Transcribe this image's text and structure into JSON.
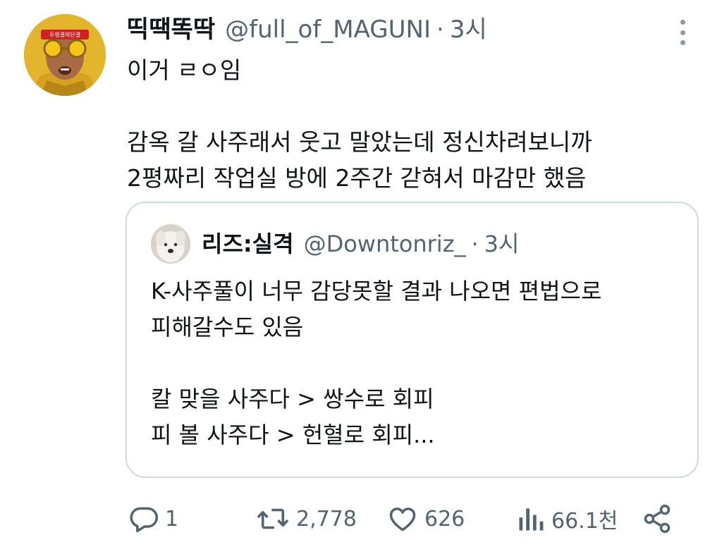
{
  "tweet": {
    "display_name": "띡땍똑딱",
    "handle": "@full_of_MAGUNI",
    "separator": "·",
    "time": "3시",
    "avatar_icon": "profile-avatar",
    "headband_text": "투쟁결의단결",
    "text": "이거 ㄹㅇ임\n\n감옥 갈 사주래서 웃고 말았는데 정신차려보니까\n2평짜리 작업실 방에 2주간 갇혀서 마감만 했음"
  },
  "quote": {
    "display_name": "리즈:실격",
    "handle": "@Downtonriz_",
    "separator": "·",
    "time": "3시",
    "avatar_icon": "dog-avatar",
    "text": "K-사주풀이 너무 감당못할 결과 나오면 편법으로\n피해갈수도 있음\n\n칼 맞을 사주다 > 쌍수로 회피\n피 볼 사주다 > 헌혈로 회피..."
  },
  "actions": {
    "reply_count": "1",
    "retweet_count": "2,778",
    "like_count": "626",
    "view_count": "66.1천"
  },
  "colors": {
    "text_primary": "#0f1419",
    "text_secondary": "#536471",
    "border": "#cfd9de",
    "background": "#ffffff"
  }
}
